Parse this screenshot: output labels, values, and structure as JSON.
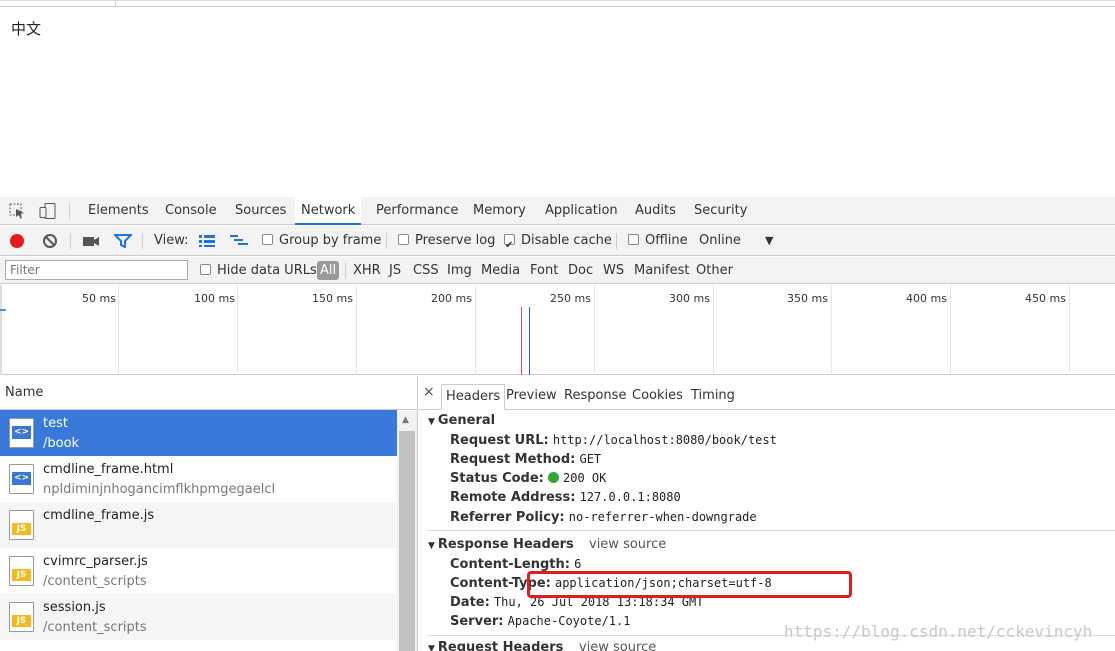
{
  "page": {
    "text": "中文"
  },
  "devtools": {
    "tabs": [
      "Elements",
      "Console",
      "Sources",
      "Network",
      "Performance",
      "Memory",
      "Application",
      "Audits",
      "Security"
    ],
    "active_tab": "Network",
    "toolbar": {
      "view_label": "View:",
      "group_by_frame": "Group by frame",
      "preserve_log": "Preserve log",
      "disable_cache": "Disable cache",
      "offline": "Offline",
      "throttle": "Online"
    },
    "filter": {
      "placeholder": "Filter",
      "hide_data_urls": "Hide data URLs",
      "types": [
        "All",
        "XHR",
        "JS",
        "CSS",
        "Img",
        "Media",
        "Font",
        "Doc",
        "WS",
        "Manifest",
        "Other"
      ]
    },
    "timeline": {
      "ticks": [
        "50 ms",
        "100 ms",
        "150 ms",
        "200 ms",
        "250 ms",
        "300 ms",
        "350 ms",
        "400 ms",
        "450 ms"
      ]
    },
    "requests": {
      "header": "Name",
      "rows": [
        {
          "name": "test",
          "path": "/book",
          "icon": "doc"
        },
        {
          "name": "cmdline_frame.html",
          "path": "npldiminjnhogancimflkhpmgegaelcl",
          "icon": "doc"
        },
        {
          "name": "cmdline_frame.js",
          "path": "",
          "icon": "js"
        },
        {
          "name": "cvimrc_parser.js",
          "path": "/content_scripts",
          "icon": "js"
        },
        {
          "name": "session.js",
          "path": "/content_scripts",
          "icon": "js"
        }
      ]
    },
    "details": {
      "close": "×",
      "tabs": [
        "Headers",
        "Preview",
        "Response",
        "Cookies",
        "Timing"
      ],
      "general": {
        "title": "General",
        "request_url_k": "Request URL:",
        "request_url_v": "http://localhost:8080/book/test",
        "method_k": "Request Method:",
        "method_v": "GET",
        "status_k": "Status Code:",
        "status_v": "200 OK",
        "remote_k": "Remote Address:",
        "remote_v": "127.0.0.1:8080",
        "referrer_k": "Referrer Policy:",
        "referrer_v": "no-referrer-when-downgrade"
      },
      "response_headers": {
        "title": "Response Headers",
        "view_source": "view source",
        "len_k": "Content-Length:",
        "len_v": "6",
        "type_k": "Content-Type:",
        "type_v": "application/json;charset=utf-8",
        "date_k": "Date:",
        "date_v": "Thu, 26 Jul 2018 13:18:34 GMT",
        "server_k": "Server:",
        "server_v": "Apache-Coyote/1.1"
      },
      "request_headers": {
        "title": "Request Headers",
        "view_source": "view source"
      }
    },
    "colors": {
      "accent": "#1a73e8",
      "selected_row": "#3879d9",
      "highlight": "#e51c1c",
      "record": "#e81b1b",
      "status_ok": "#2fa82f"
    }
  },
  "watermark": "https://blog.csdn.net/cckevincyh"
}
